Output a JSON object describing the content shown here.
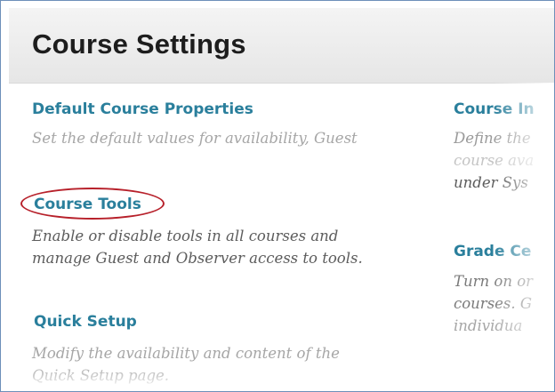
{
  "header": {
    "title": "Course Settings"
  },
  "left": {
    "default_properties": {
      "label": "Default Course Properties",
      "desc_line1": "Set the default values for availability, Guest"
    },
    "course_tools": {
      "label": "Course Tools",
      "desc_line1": "Enable or disable tools in all courses and",
      "desc_line2": "manage Guest and Observer access to tools."
    },
    "quick_setup": {
      "label": "Quick Setup",
      "desc_line1": "Modify the availability and content of the",
      "desc_line2": "Quick Setup page."
    }
  },
  "right": {
    "course_inherit": {
      "label": "Course In",
      "desc_line1": "Define the",
      "desc_line2": "course ava",
      "desc_line3": "under Sys"
    },
    "grade_center": {
      "label": "Grade Ce",
      "desc_line1": "Turn on or",
      "desc_line2": "courses. G",
      "desc_line3": "individua"
    }
  },
  "colors": {
    "link": "#2a7f9c",
    "highlight_oval": "#b7202a"
  }
}
